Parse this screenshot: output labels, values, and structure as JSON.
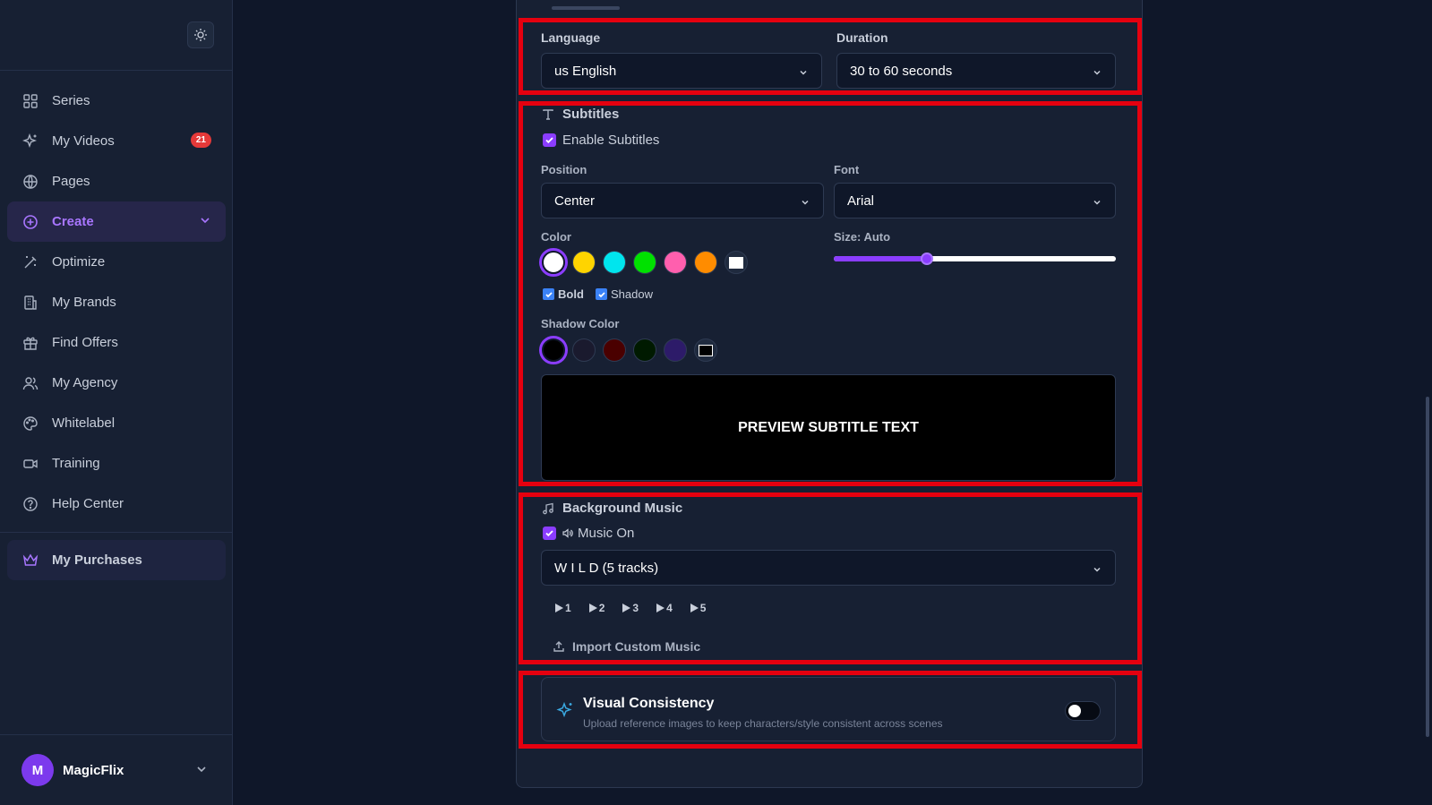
{
  "sidebar": {
    "items": [
      {
        "label": "Series",
        "icon": "grid-icon"
      },
      {
        "label": "My Videos",
        "icon": "sparkles-icon",
        "badge": "21"
      },
      {
        "label": "Pages",
        "icon": "globe-icon"
      },
      {
        "label": "Create",
        "icon": "plus-circle-icon"
      },
      {
        "label": "Optimize",
        "icon": "wand-icon"
      },
      {
        "label": "My Brands",
        "icon": "building-icon"
      },
      {
        "label": "Find Offers",
        "icon": "gift-icon"
      },
      {
        "label": "My Agency",
        "icon": "users-icon"
      },
      {
        "label": "Whitelabel",
        "icon": "palette-icon"
      },
      {
        "label": "Training",
        "icon": "video-camera-icon"
      },
      {
        "label": "Help Center",
        "icon": "help-circle-icon"
      }
    ],
    "purchases": {
      "label": "My Purchases",
      "icon": "crown-icon"
    },
    "user": {
      "initial": "M",
      "name": "MagicFlix"
    }
  },
  "settings": {
    "language": {
      "label": "Language",
      "value": "us English"
    },
    "duration": {
      "label": "Duration",
      "value": "30 to 60 seconds"
    },
    "subtitles": {
      "title": "Subtitles",
      "enable_label": "Enable Subtitles",
      "position": {
        "label": "Position",
        "value": "Center"
      },
      "font": {
        "label": "Font",
        "value": "Arial"
      },
      "color_label": "Color",
      "size_label": "Size: Auto",
      "size_level": 0.33,
      "bold_label": "Bold",
      "shadow_label": "Shadow",
      "shadow_color_label": "Shadow Color",
      "preview_text": "PREVIEW SUBTITLE TEXT",
      "colors": [
        "#ffffff",
        "#ffd400",
        "#00e5ee",
        "#00e100",
        "#ff5fae",
        "#ff8c00"
      ],
      "shadow_colors": [
        "#000000",
        "#1a1a2e",
        "#4a0000",
        "#001a00",
        "#2d1b69"
      ]
    },
    "music": {
      "title": "Background Music",
      "toggle_label": "Music On",
      "selection": "W I L D (5 tracks)",
      "tracks": [
        "1",
        "2",
        "3",
        "4",
        "5"
      ],
      "import_label": "Import Custom Music"
    },
    "visual_consistency": {
      "title": "Visual Consistency",
      "description": "Upload reference images to keep characters/style consistent across scenes",
      "enabled": false
    }
  },
  "colors": {
    "accent": "#8b3dff",
    "highlight": "#e5000f",
    "badge": "#e53939"
  }
}
